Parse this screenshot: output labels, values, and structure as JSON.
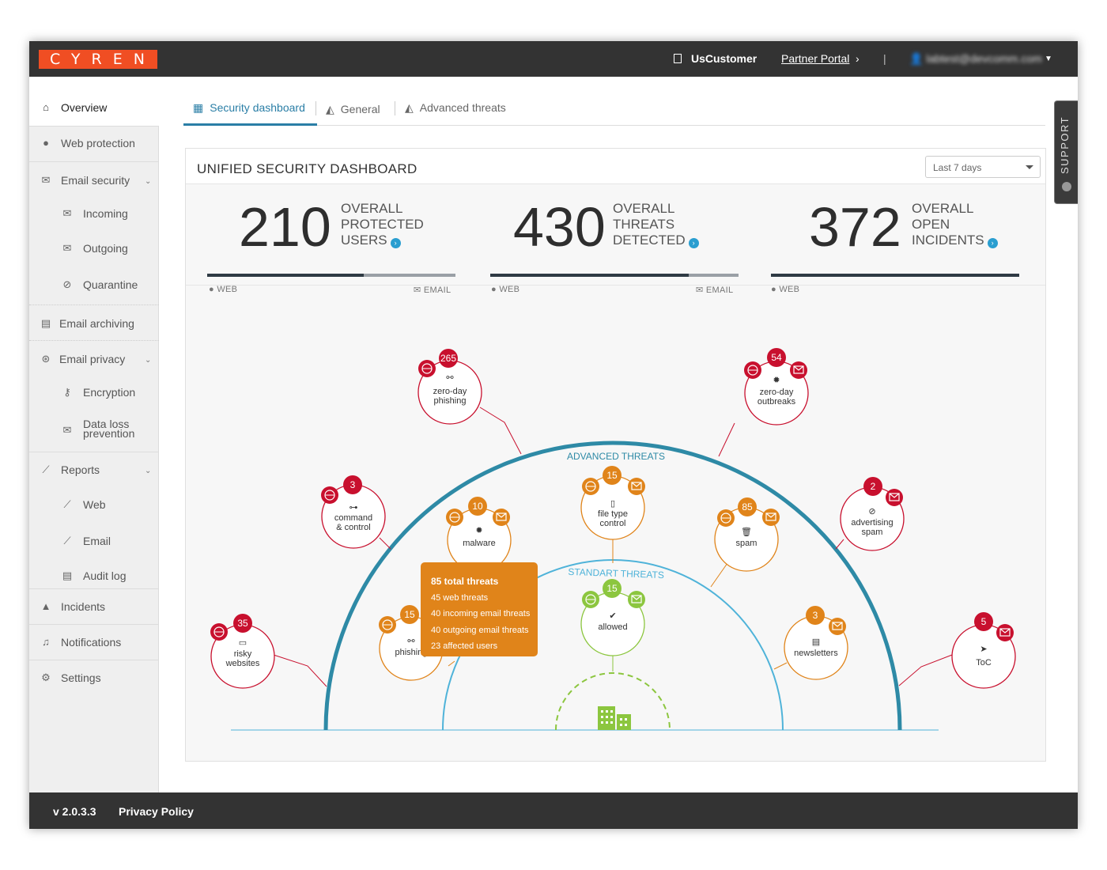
{
  "brand": {
    "logo_text": "CYREN",
    "color": "#f04e23"
  },
  "topbar": {
    "customer": "UsCustomer",
    "partner_portal": "Partner Portal",
    "separator": "|",
    "user": "labtest@devcomm.com"
  },
  "sidebar": {
    "overview": "Overview",
    "web_protection": "Web protection",
    "email_security": "Email security",
    "incoming": "Incoming",
    "outgoing": "Outgoing",
    "quarantine": "Quarantine",
    "email_archiving": "Email archiving",
    "email_privacy": "Email privacy",
    "encryption": "Encryption",
    "dlp_line1": "Data loss",
    "dlp_line2": "prevention",
    "reports": "Reports",
    "reports_web": "Web",
    "reports_email": "Email",
    "audit_log": "Audit log",
    "incidents": "Incidents",
    "notifications": "Notifications",
    "settings": "Settings"
  },
  "tabs": {
    "security_dashboard": "Security dashboard",
    "general": "General",
    "advanced_threats": "Advanced threats"
  },
  "support": "SUPPORT",
  "panel": {
    "title": "UNIFIED SECURITY DASHBOARD",
    "range": "Last 7 days"
  },
  "stats": [
    {
      "value": "210",
      "line1": "OVERALL",
      "line2": "PROTECTED",
      "line3": "USERS",
      "web_label": "WEB",
      "email_label": "EMAIL",
      "web_fraction": 0.63
    },
    {
      "value": "430",
      "line1": "OVERALL",
      "line2": "THREATS",
      "line3": "DETECTED",
      "web_label": "WEB",
      "email_label": "EMAIL",
      "web_fraction": 0.8
    },
    {
      "value": "372",
      "line1": "OVERALL",
      "line2": "OPEN",
      "line3": "INCIDENTS",
      "web_label": "WEB",
      "web_fraction": 1.0
    }
  ],
  "arcs": {
    "advanced": "ADVANCED THREATS",
    "standard": "STANDART THREATS"
  },
  "nodes": {
    "zero_day_phishing": {
      "count": "265",
      "l1": "zero-day",
      "l2": "phishing"
    },
    "zero_day_outbreaks": {
      "count": "54",
      "l1": "zero-day",
      "l2": "outbreaks"
    },
    "command_control": {
      "count": "3",
      "l1": "command",
      "l2": "& control"
    },
    "advertising_spam": {
      "count": "2",
      "l1": "advertising",
      "l2": "spam"
    },
    "risky_websites": {
      "count": "35",
      "l1": "risky",
      "l2": "websites"
    },
    "toc": {
      "count": "5",
      "l1": "ToC"
    },
    "malware": {
      "count": "10",
      "l1": "malware"
    },
    "file_type": {
      "count": "15",
      "l1": "file type",
      "l2": "control"
    },
    "spam": {
      "count": "85",
      "l1": "spam"
    },
    "phishing": {
      "count": "15",
      "l1": "phishing"
    },
    "newsletters": {
      "count": "3",
      "l1": "newsletters"
    },
    "allowed": {
      "count": "15",
      "l1": "allowed"
    }
  },
  "tooltip": {
    "title": "85 total threats",
    "web": "45 web threats",
    "incoming": "40 incoming email threats",
    "outgoing": "40 outgoing email threats",
    "users": "23 affected users"
  },
  "colors": {
    "red": "#c8102e",
    "orange": "#e0841a",
    "green": "#8cc63f",
    "teal": "#2e8aa6",
    "light_blue": "#4fb3d9"
  },
  "footer": {
    "version": "v 2.0.3.3",
    "privacy": "Privacy Policy"
  }
}
